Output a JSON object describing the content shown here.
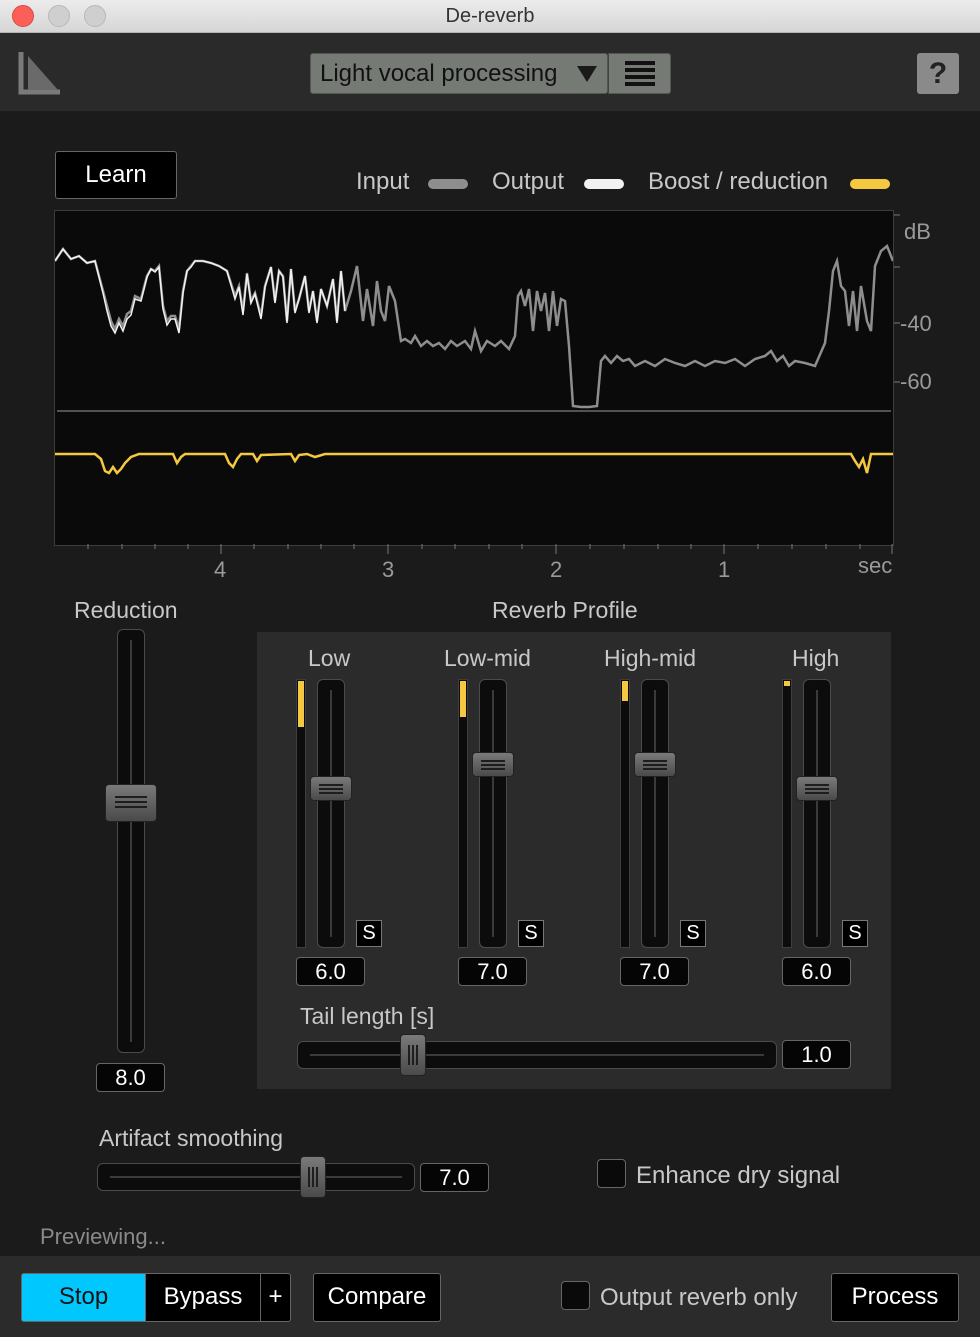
{
  "window": {
    "title": "De-reverb"
  },
  "header": {
    "preset_name": "Light vocal processing",
    "help_label": "?"
  },
  "learn_label": "Learn",
  "legend": [
    {
      "label": "Input",
      "color": "#8e8e8e"
    },
    {
      "label": "Output",
      "color": "#f2f2f2"
    },
    {
      "label": "Boost / reduction",
      "color": "#f5c842"
    }
  ],
  "graph": {
    "db_unit": "dB",
    "db_ticks": [
      "-40",
      "-60"
    ],
    "time_ticks": [
      "4",
      "3",
      "2",
      "1"
    ],
    "time_unit": "sec"
  },
  "reduction": {
    "label": "Reduction",
    "value": "8.0",
    "level": 0.35
  },
  "reverb_profile": {
    "title": "Reverb Profile",
    "bands": [
      {
        "label": "Low",
        "value": "6.0",
        "solo": "S",
        "level": 0.4,
        "meter": 0.18
      },
      {
        "label": "Low-mid",
        "value": "7.0",
        "solo": "S",
        "level": 0.3,
        "meter": 0.14
      },
      {
        "label": "High-mid",
        "value": "7.0",
        "solo": "S",
        "level": 0.3,
        "meter": 0.08
      },
      {
        "label": "High",
        "value": "6.0",
        "solo": "S",
        "level": 0.4,
        "meter": 0.02
      }
    ],
    "tail_length": {
      "label": "Tail length [s]",
      "value": "1.0",
      "level": 0.24
    }
  },
  "artifact_smoothing": {
    "label": "Artifact smoothing",
    "value": "7.0",
    "level": 0.7
  },
  "enhance_dry": {
    "label": "Enhance dry signal",
    "checked": false
  },
  "status": "Previewing...",
  "footer": {
    "stop": "Stop",
    "bypass": "Bypass",
    "plus": "+",
    "compare": "Compare",
    "output_reverb_only": "Output reverb only",
    "process": "Process"
  },
  "colors": {
    "accent": "#00c8ff",
    "reduction_curve": "#f5c842"
  }
}
